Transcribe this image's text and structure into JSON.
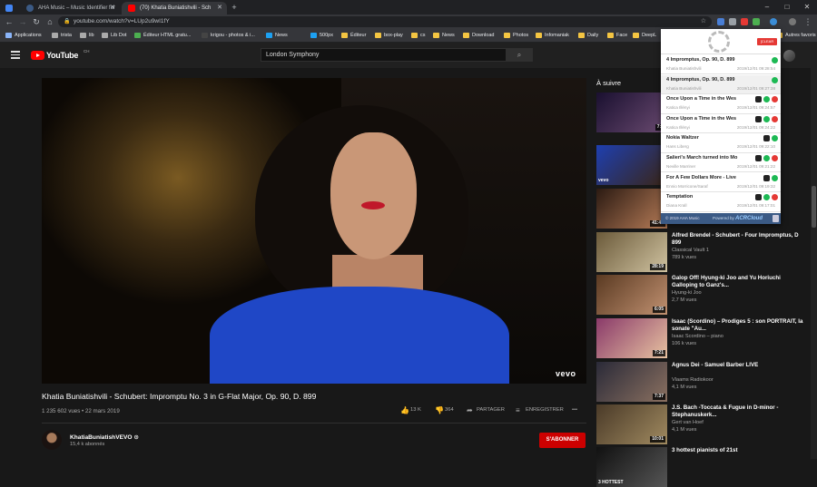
{
  "tabs": [
    {
      "title": "",
      "icon": "vpn-icon",
      "color": "#4285f4"
    },
    {
      "title": "AHA Music – Music Identifier for",
      "color": "#3b5a85"
    },
    {
      "title": "(70) Khatia Buniatishvili - Sch",
      "color": "#ff0000"
    }
  ],
  "window_buttons": [
    "–",
    "□",
    "✕"
  ],
  "nav": {
    "back": "←",
    "forward": "→",
    "reload": "↻",
    "home": "⌂",
    "new_tab": "+"
  },
  "url": "youtube.com/watch?v=LUp2u9wI1fY",
  "bookmarks": [
    {
      "label": "Applications",
      "color": "#8ab4f8"
    },
    {
      "label": "trista",
      "color": "#aaa"
    },
    {
      "label": "lib",
      "color": "#aaa"
    },
    {
      "label": "Lib Dot",
      "color": "#aaa"
    },
    {
      "label": "Éditeur HTML gratu...",
      "color": "#4caf50"
    },
    {
      "label": "krigou - photos & i...",
      "color": "#444"
    },
    {
      "label": "News",
      "color": "#1da1f2"
    },
    {
      "label": "500px",
      "color": "#1da1f2"
    },
    {
      "label": "Éditeur",
      "color": "#f4c542"
    },
    {
      "label": "box-play",
      "color": "#f4c542"
    },
    {
      "label": "cs",
      "color": "#f4c542"
    },
    {
      "label": "News",
      "color": "#f4c542"
    },
    {
      "label": "Download",
      "color": "#f4c542"
    },
    {
      "label": "Photos",
      "color": "#f4c542"
    },
    {
      "label": "Infomaniak",
      "color": "#f4c542"
    },
    {
      "label": "Daily",
      "color": "#f4c542"
    },
    {
      "label": "Face",
      "color": "#f4c542"
    },
    {
      "label": "DeepL",
      "color": "#f4c542"
    }
  ],
  "bookmarks_more": "Autres favoris",
  "youtube": {
    "logo": "YouTube",
    "country": "CH",
    "search_value": "London Symphony",
    "search_icon": "search-icon"
  },
  "video": {
    "title": "Khatia Buniatishvili - Schubert: Impromptu No. 3 in G-Flat Major, Op. 90, D. 899",
    "meta": "1 235 602 vues • 22 mars 2019",
    "watermark": "vevo",
    "likes": "13 K",
    "dislikes": "364",
    "share": "PARTAGER",
    "save": "ENREGISTRER",
    "more": "•••"
  },
  "channel": {
    "name": "KhatiaBuniatishVEVO ⊙",
    "subs": "15,4 k abonnés",
    "subscribe": "S'ABONNER"
  },
  "upnext": {
    "heading": "À suivre",
    "cards": [
      {
        "title": "",
        "channel": "",
        "views": "",
        "duration": "7:4",
        "colors": [
          "#1a1030",
          "#6a4a70"
        ],
        "vevo": ""
      },
      {
        "title": "",
        "channel": "",
        "views": "",
        "duration": "",
        "colors": [
          "#1e3fb0",
          "#3a2515"
        ],
        "vevo": "vevo"
      },
      {
        "title": "",
        "channel": "",
        "views": "",
        "duration": "41:48",
        "colors": [
          "#2b1a12",
          "#b87d58"
        ],
        "vevo": ""
      },
      {
        "title": "Alfred Brendel - Schubert - Four Impromptus, D 899",
        "channel": "Classical Vault 1",
        "views": "789 k vues",
        "duration": "28:19",
        "colors": [
          "#6b5a3a",
          "#cfc2a0"
        ],
        "vevo": ""
      },
      {
        "title": "Galop Off! Hyung-ki Joo and Yu Horiuchi Galloping to Ganz's...",
        "channel": "Hyung-ki Joo",
        "views": "2,7 M vues",
        "duration": "6:05",
        "colors": [
          "#5a3a22",
          "#c09070"
        ],
        "vevo": ""
      },
      {
        "title": "Isaac (Scordino) – Prodiges 5 : son PORTRAIT, la sonate \"Au...",
        "channel": "Isaac Scordino – piano",
        "views": "106 k vues",
        "duration": "7:21",
        "colors": [
          "#8a3a6a",
          "#e7c2a0"
        ],
        "vevo": ""
      },
      {
        "title": "Agnus Dei - Samuel Barber LIVE",
        "channel": "Vlaams Radiokoor",
        "views": "4,1 M vues",
        "duration": "7:37",
        "colors": [
          "#2a2a38",
          "#8a7060"
        ],
        "vevo": ""
      },
      {
        "title": "J.S. Bach -Toccata & Fugue in D-minor - Stephanuskerk...",
        "channel": "Gert van Hoef",
        "views": "4,1 M vues",
        "duration": "10:01",
        "colors": [
          "#4a3a28",
          "#a08a60"
        ],
        "vevo": ""
      },
      {
        "title": "3 hottest pianists of 21st",
        "channel": "",
        "views": "",
        "duration": "",
        "colors": [
          "#111111",
          "#555555"
        ],
        "vevo": "3 HOTTEST"
      }
    ]
  },
  "aha": {
    "clear": "[CLEAR ALL]",
    "songs": [
      {
        "title": "4 Impromptus, Op. 90, D. 899",
        "artist": "Khatia Buniatishvili",
        "date": "2019/12/01 09:28:54",
        "icons": [
          "sp"
        ]
      },
      {
        "title": "4 Impromptus, Op. 90, D. 899",
        "artist": "Khatia Buniatishvili",
        "date": "2019/12/01 09:27:38",
        "icons": [
          "sp"
        ]
      },
      {
        "title": "Once Upon a Time in the Wes",
        "artist": "Katica Illényi",
        "date": "2019/12/01 09:24:57",
        "icons": [
          "dz",
          "sp",
          "yt"
        ]
      },
      {
        "title": "Once Upon a Time in the Wes",
        "artist": "Katica Illényi",
        "date": "2019/12/01 09:24:22",
        "icons": [
          "dz",
          "sp",
          "yt"
        ]
      },
      {
        "title": "Nokia Waltzer",
        "artist": "Hans Liberg",
        "date": "2019/12/01 09:22:10",
        "icons": [
          "dz",
          "sp"
        ]
      },
      {
        "title": "Salieri's March turned into Mo",
        "artist": "Neville Marriner",
        "date": "2019/12/01 09:21:22",
        "icons": [
          "dz",
          "sp",
          "yt"
        ]
      },
      {
        "title": "For A Few Dollars More - Live",
        "artist": "Ennio Morricone/Saraf",
        "date": "2019/12/01 09:19:32",
        "icons": [
          "dz",
          "sp"
        ]
      },
      {
        "title": "Temptation",
        "artist": "Diana Krall",
        "date": "2019/12/01 09:17:01",
        "icons": [
          "dz",
          "sp",
          "yt"
        ]
      }
    ],
    "footer": "© 2019 AHA Music",
    "powered": "Powered by",
    "acr": "ACRCloud"
  }
}
